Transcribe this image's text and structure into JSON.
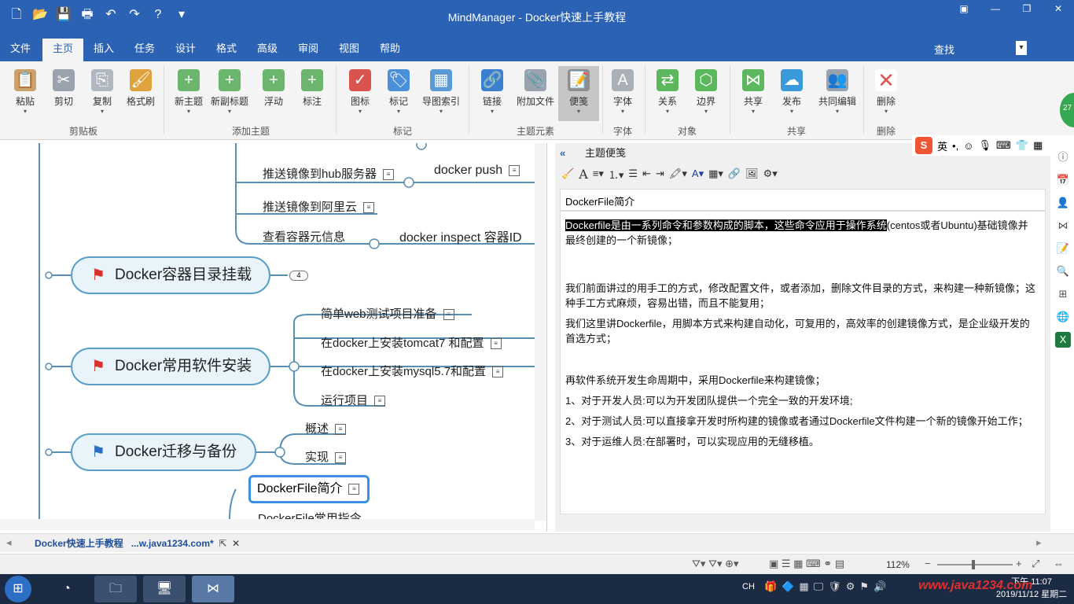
{
  "window": {
    "title": "MindManager - Docker快速上手教程"
  },
  "menu": {
    "tabs": [
      "文件",
      "主页",
      "插入",
      "任务",
      "设计",
      "格式",
      "高级",
      "审阅",
      "视图",
      "帮助"
    ],
    "search_label": "查找"
  },
  "ribbon": {
    "buttons": [
      "粘贴",
      "剪切",
      "复制",
      "格式刷",
      "新主题",
      "新副标题",
      "浮动",
      "标注",
      "图标",
      "标记",
      "导图索引",
      "链接",
      "附加文件",
      "便笺",
      "字体",
      "关系",
      "边界",
      "共享",
      "发布",
      "共同编辑",
      "删除"
    ],
    "groups": [
      "剪贴板",
      "添加主题",
      "标记",
      "主题元素",
      "字体",
      "对象",
      "共享",
      "删除"
    ],
    "badge": "27"
  },
  "map": {
    "subtopics": [
      "推送镜像到hub服务器",
      "docker push",
      "推送镜像到阿里云",
      "查看容器元信息",
      "docker inspect 容器ID",
      "简单web测试项目准备",
      "在docker上安装tomcat7 和配置",
      "在docker上安装mysql5.7和配置",
      "运行项目",
      "概述",
      "实现",
      "DockerFile常用指令"
    ],
    "topics": [
      "Docker容器目录挂载",
      "Docker常用软件安装",
      "Docker迁移与备份"
    ],
    "collapsed_count": "4",
    "selected": "DockerFile简介"
  },
  "panel": {
    "header": "主题便笺",
    "close": "关闭",
    "note_title": "DockerFile简介",
    "highlighted": "Dockerfile是由一系列命令和参数构成的脚本，这些命令应用于操作系统",
    "para1_rest": "(centos或者Ubuntu)基础镜像并最终创建的一个新镜像；",
    "para2": "我们前面讲过的用手工的方式，修改配置文件，或者添加，删除文件目录的方式，来构建一种新镜像；这种手工方式麻烦，容易出错，而且不能复用；",
    "para3": "我们这里讲Dockerfile，用脚本方式来构建自动化，可复用的，高效率的创建镜像方式，是企业级开发的首选方式；",
    "para4": "再软件系统开发生命周期中，采用Dockerfile来构建镜像；",
    "para5": "1、对于开发人员:可以为开发团队提供一个完全一致的开发环境;",
    "para6": "2、对于测试人员:可以直接拿开发时所构建的镜像或者通过Dockerfile文件构建一个新的镜像开始工作；",
    "para7": "3、对于运维人员:在部署时，可以实现应用的无缝移植。"
  },
  "ime": {
    "lang": "英"
  },
  "doctab": {
    "name": "Docker快速上手教程",
    "path": "...w.java1234.com*"
  },
  "status": {
    "zoom": "112%"
  },
  "taskbar": {
    "lang": "CH",
    "time": "下午 11:07",
    "date": "2019/11/12 星期二",
    "watermark": "www.java1234.com"
  }
}
